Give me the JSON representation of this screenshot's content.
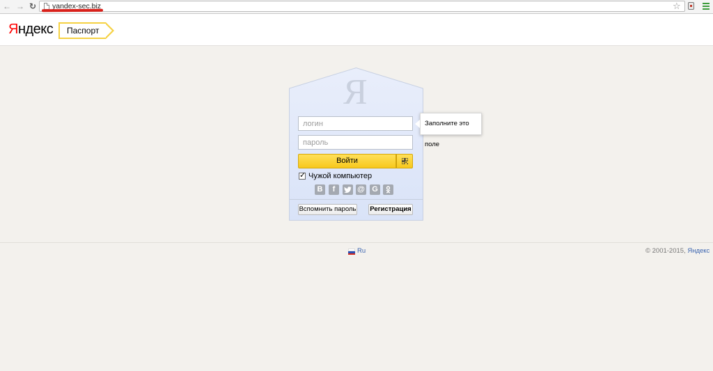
{
  "browser": {
    "url": "yandex-sec.biz"
  },
  "header": {
    "logo_first": "Я",
    "logo_rest": "ндекс",
    "section_tab": "Паспорт"
  },
  "login_form": {
    "emblem": "Я",
    "login_placeholder": "логин",
    "password_placeholder": "пароль",
    "submit_label": "Войти",
    "checkbox_label": "Чужой компьютер",
    "checkbox_checked": true,
    "social_icons": [
      "vkontakte-icon",
      "facebook-icon",
      "twitter-icon",
      "mailru-icon",
      "google-icon",
      "odnoklassniki-icon"
    ],
    "social_letters": [
      "В",
      "f",
      "",
      "@",
      "G",
      ""
    ],
    "forgot_label": "Вспомнить пароль",
    "register_label": "Регистрация"
  },
  "tooltip": {
    "text": "Заполните это поле"
  },
  "footer": {
    "language": "Ru",
    "copyright_prefix": "© 2001-2015, ",
    "copyright_link": "Яндекс"
  },
  "colors": {
    "logo_red": "#ff0000",
    "button_yellow": "#f7c81c",
    "card_bg": "#dfe8fb",
    "link_blue": "#3c65b0",
    "annotation_red": "#d9201a"
  }
}
